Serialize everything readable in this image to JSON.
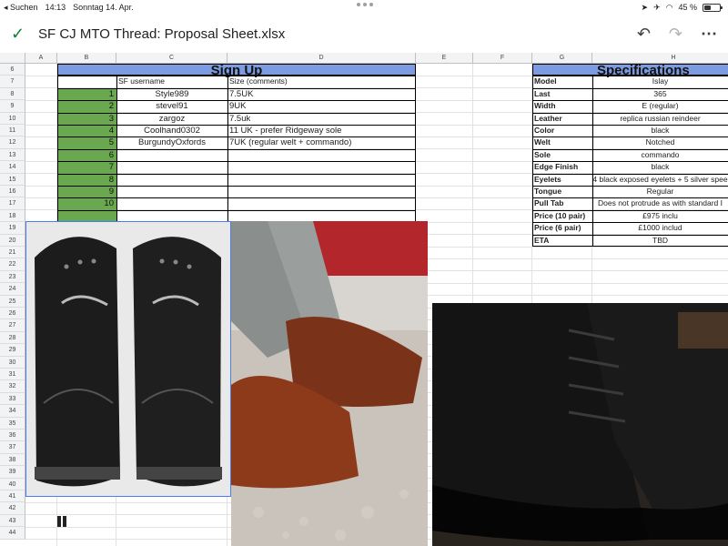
{
  "status": {
    "back_app": "Suchen",
    "time": "14:13",
    "date": "Sonntag 14. Apr.",
    "battery_text": "45 %",
    "battery_level": 0.45
  },
  "app": {
    "title": "SF CJ MTO Thread: Proposal Sheet.xlsx"
  },
  "columns": [
    "A",
    "B",
    "C",
    "D",
    "E",
    "F",
    "G",
    "H"
  ],
  "rows": [
    "6",
    "7",
    "8",
    "9",
    "10",
    "11",
    "12",
    "13",
    "14",
    "15",
    "16",
    "17",
    "18",
    "19",
    "20",
    "21",
    "22",
    "23",
    "24",
    "25",
    "26",
    "27",
    "28",
    "29",
    "30",
    "31",
    "32",
    "33",
    "34",
    "35",
    "36",
    "37",
    "38",
    "39",
    "40",
    "41",
    "42",
    "43",
    "44"
  ],
  "signup": {
    "title": "Sign Up",
    "col_username": "SF username",
    "col_size": "Size (comments)",
    "entries": [
      {
        "n": "1",
        "user": "Style989",
        "size": "7.5UK"
      },
      {
        "n": "2",
        "user": "stevel91",
        "size": "9UK"
      },
      {
        "n": "3",
        "user": "zargoz",
        "size": "7.5uk"
      },
      {
        "n": "4",
        "user": "Coolhand0302",
        "size": "11 UK - prefer Ridgeway sole"
      },
      {
        "n": "5",
        "user": "BurgundyOxfords",
        "size": " 7UK  (regular welt + commando)"
      },
      {
        "n": "6",
        "user": "",
        "size": ""
      },
      {
        "n": "7",
        "user": "",
        "size": ""
      },
      {
        "n": "8",
        "user": "",
        "size": ""
      },
      {
        "n": "9",
        "user": "",
        "size": ""
      },
      {
        "n": "10",
        "user": "",
        "size": ""
      }
    ]
  },
  "specs": {
    "title": "Specifications",
    "items": [
      {
        "label": "Model",
        "value": "Islay"
      },
      {
        "label": "Last",
        "value": "365"
      },
      {
        "label": "Width",
        "value": "E (regular)"
      },
      {
        "label": "Leather",
        "value": "replica russian reindeer"
      },
      {
        "label": "Color",
        "value": "black"
      },
      {
        "label": "Welt",
        "value": "Notched"
      },
      {
        "label": "Sole",
        "value": "commando"
      },
      {
        "label": "Edge Finish",
        "value": "black"
      },
      {
        "label": "Eyelets",
        "value": "4  black exposed eyelets + 5 silver spee"
      },
      {
        "label": "Tongue",
        "value": "Regular"
      },
      {
        "label": "Pull Tab",
        "value": "Does not protrude as with standard I"
      },
      {
        "label": "Price (10 pair)",
        "value": "£975 inclu"
      },
      {
        "label": "Price (6 pair)",
        "value": "£1000 includ"
      },
      {
        "label": "ETA",
        "value": "TBD"
      }
    ]
  },
  "icons": {
    "check": "check-icon",
    "undo": "undo-icon",
    "redo": "redo-icon",
    "more": "more-icon"
  }
}
